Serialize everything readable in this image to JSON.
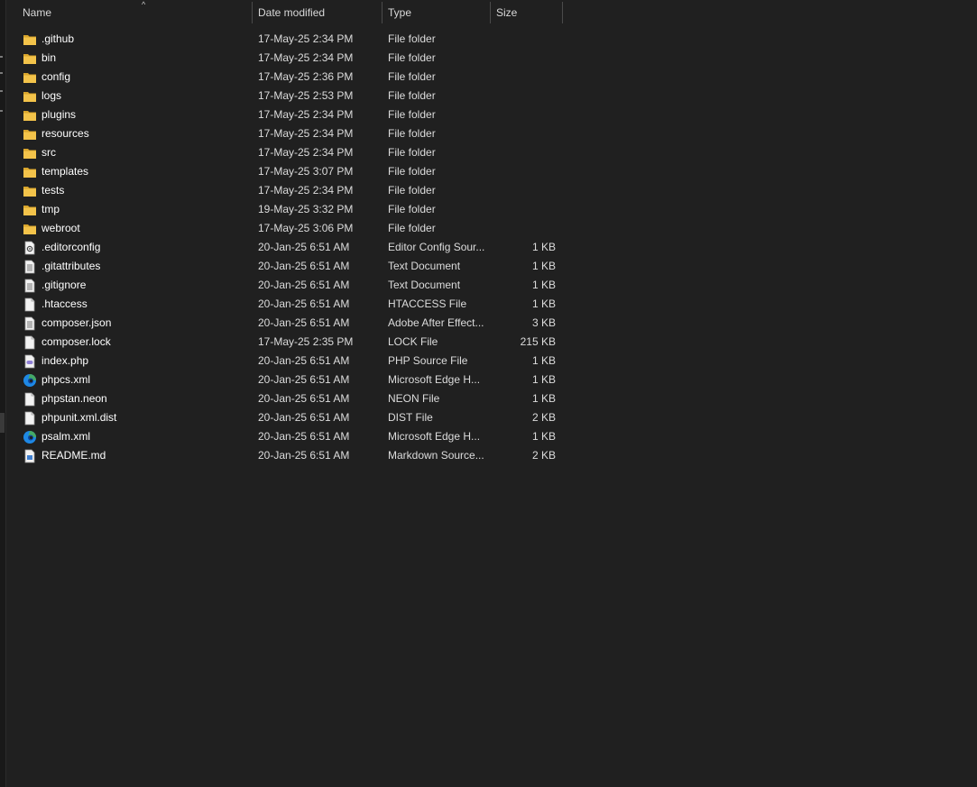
{
  "columns": {
    "name": "Name",
    "date": "Date modified",
    "type": "Type",
    "size": "Size"
  },
  "sort_indicator": "^",
  "icon_colors": {
    "folder": "#f3c34a",
    "folder_dark": "#d9a52c",
    "file": "#f2f2f2",
    "edge_blue": "#1e88e5",
    "edge_green": "#4caf50"
  },
  "files": [
    {
      "name": ".github",
      "date": "17-May-25 2:34 PM",
      "type": "File folder",
      "size": "",
      "icon": "folder-icon"
    },
    {
      "name": "bin",
      "date": "17-May-25 2:34 PM",
      "type": "File folder",
      "size": "",
      "icon": "folder-icon"
    },
    {
      "name": "config",
      "date": "17-May-25 2:36 PM",
      "type": "File folder",
      "size": "",
      "icon": "folder-icon"
    },
    {
      "name": "logs",
      "date": "17-May-25 2:53 PM",
      "type": "File folder",
      "size": "",
      "icon": "folder-icon"
    },
    {
      "name": "plugins",
      "date": "17-May-25 2:34 PM",
      "type": "File folder",
      "size": "",
      "icon": "folder-icon"
    },
    {
      "name": "resources",
      "date": "17-May-25 2:34 PM",
      "type": "File folder",
      "size": "",
      "icon": "folder-icon"
    },
    {
      "name": "src",
      "date": "17-May-25 2:34 PM",
      "type": "File folder",
      "size": "",
      "icon": "folder-icon"
    },
    {
      "name": "templates",
      "date": "17-May-25 3:07 PM",
      "type": "File folder",
      "size": "",
      "icon": "folder-icon"
    },
    {
      "name": "tests",
      "date": "17-May-25 2:34 PM",
      "type": "File folder",
      "size": "",
      "icon": "folder-icon"
    },
    {
      "name": "tmp",
      "date": "19-May-25 3:32 PM",
      "type": "File folder",
      "size": "",
      "icon": "folder-icon"
    },
    {
      "name": "webroot",
      "date": "17-May-25 3:06 PM",
      "type": "File folder",
      "size": "",
      "icon": "folder-icon"
    },
    {
      "name": ".editorconfig",
      "date": "20-Jan-25 6:51 AM",
      "type": "Editor Config Sour...",
      "size": "1 KB",
      "icon": "config-file-icon"
    },
    {
      "name": ".gitattributes",
      "date": "20-Jan-25 6:51 AM",
      "type": "Text Document",
      "size": "1 KB",
      "icon": "text-file-icon"
    },
    {
      "name": ".gitignore",
      "date": "20-Jan-25 6:51 AM",
      "type": "Text Document",
      "size": "1 KB",
      "icon": "text-file-icon"
    },
    {
      "name": ".htaccess",
      "date": "20-Jan-25 6:51 AM",
      "type": "HTACCESS File",
      "size": "1 KB",
      "icon": "blank-file-icon"
    },
    {
      "name": "composer.json",
      "date": "20-Jan-25 6:51 AM",
      "type": "Adobe After Effect...",
      "size": "3 KB",
      "icon": "text-file-icon"
    },
    {
      "name": "composer.lock",
      "date": "17-May-25 2:35 PM",
      "type": "LOCK File",
      "size": "215 KB",
      "icon": "blank-file-icon"
    },
    {
      "name": "index.php",
      "date": "20-Jan-25 6:51 AM",
      "type": "PHP Source File",
      "size": "1 KB",
      "icon": "php-file-icon"
    },
    {
      "name": "phpcs.xml",
      "date": "20-Jan-25 6:51 AM",
      "type": "Microsoft Edge H...",
      "size": "1 KB",
      "icon": "edge-icon"
    },
    {
      "name": "phpstan.neon",
      "date": "20-Jan-25 6:51 AM",
      "type": "NEON File",
      "size": "1 KB",
      "icon": "blank-file-icon"
    },
    {
      "name": "phpunit.xml.dist",
      "date": "20-Jan-25 6:51 AM",
      "type": "DIST File",
      "size": "2 KB",
      "icon": "blank-file-icon"
    },
    {
      "name": "psalm.xml",
      "date": "20-Jan-25 6:51 AM",
      "type": "Microsoft Edge H...",
      "size": "1 KB",
      "icon": "edge-icon"
    },
    {
      "name": "README.md",
      "date": "20-Jan-25 6:51 AM",
      "type": "Markdown Source...",
      "size": "2 KB",
      "icon": "markdown-file-icon"
    }
  ]
}
